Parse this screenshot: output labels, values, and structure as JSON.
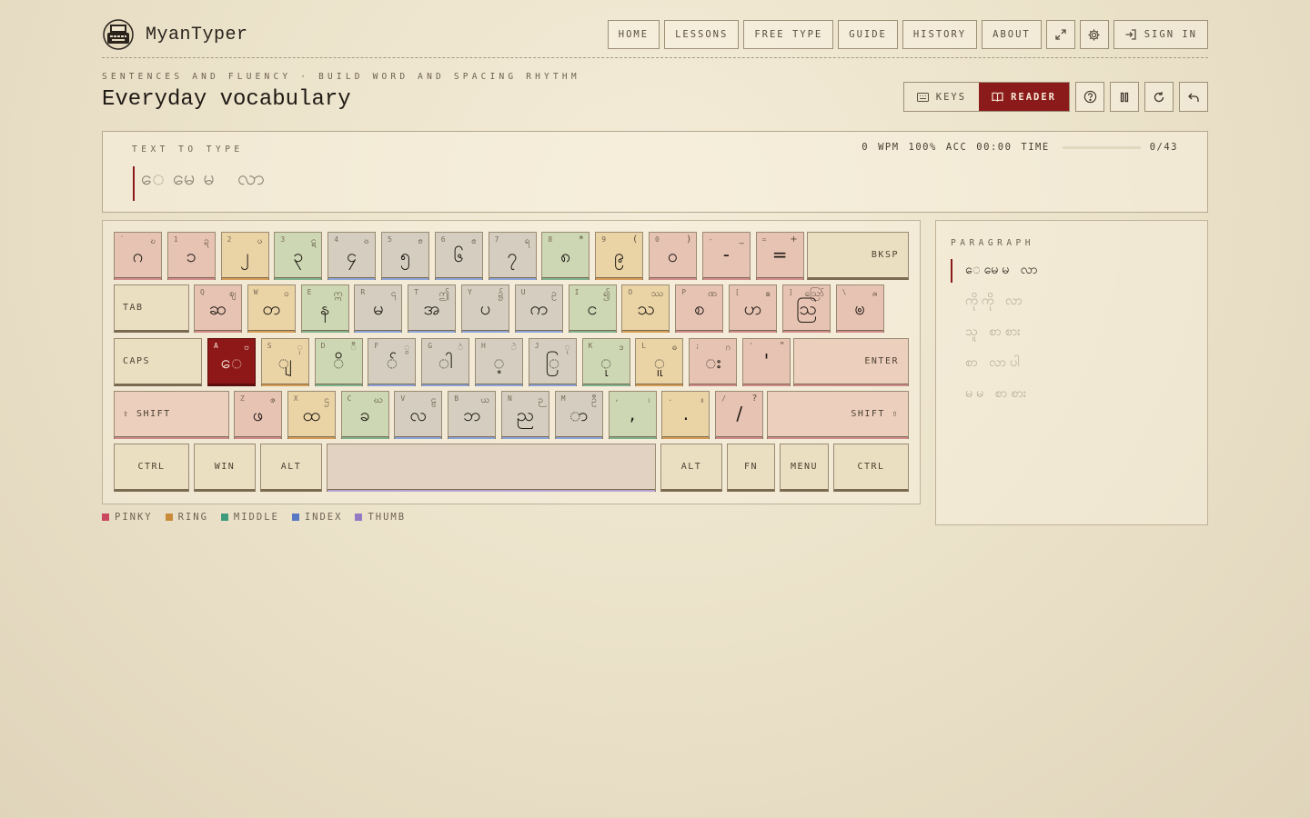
{
  "app": {
    "name": "MyanTyper"
  },
  "nav": {
    "home": "HOME",
    "lessons": "LESSONS",
    "free_type": "FREE TYPE",
    "guide": "GUIDE",
    "history": "HISTORY",
    "about": "ABOUT",
    "sign_in": "SIGN IN"
  },
  "lesson": {
    "eyebrow": "SENTENCES AND FLUENCY · BUILD WORD AND SPACING RHYTHM",
    "title": "Everyday vocabulary"
  },
  "modes": {
    "keys": "KEYS",
    "reader": "READER",
    "active": "reader"
  },
  "text_panel": {
    "label": "TEXT TO TYPE",
    "target": "ေမေမ လာ",
    "wpm": "0",
    "wpm_label": "WPM",
    "acc": "100%",
    "acc_label": "ACC",
    "time": "00:00",
    "time_label": "TIME",
    "progress_fraction": 0,
    "count": "0/43"
  },
  "keyboard": {
    "rows": [
      [
        {
          "l": "`",
          "m": "ဂ",
          "s": "ဎ",
          "f": "pinky"
        },
        {
          "l": "1",
          "m": "၁",
          "s": "ဍ",
          "f": "pinky"
        },
        {
          "l": "2",
          "m": "၂",
          "s": "ၒ",
          "f": "ring"
        },
        {
          "l": "3",
          "m": "၃",
          "s": "ဋ",
          "f": "middle"
        },
        {
          "l": "4",
          "m": "၄",
          "s": "ၓ",
          "f": "index"
        },
        {
          "l": "5",
          "m": "၅",
          "s": "ၔ",
          "f": "index"
        },
        {
          "l": "6",
          "m": "၆",
          "s": "ၕ",
          "f": "index"
        },
        {
          "l": "7",
          "m": "၇",
          "s": "ရ",
          "f": "index"
        },
        {
          "l": "8",
          "m": "၈",
          "s": "*",
          "f": "middle"
        },
        {
          "l": "9",
          "m": "၉",
          "s": "(",
          "f": "ring"
        },
        {
          "l": "0",
          "m": "၀",
          "s": ")",
          "f": "pinky"
        },
        {
          "l": "-",
          "m": "-",
          "s": "_",
          "f": "pinky"
        },
        {
          "l": "=",
          "m": "=",
          "s": "+",
          "f": "pinky"
        }
      ],
      [
        {
          "l": "Q",
          "m": "ဆ",
          "s": "ဈ",
          "f": "pinky"
        },
        {
          "l": "W",
          "m": "တ",
          "s": "ဝ",
          "f": "ring"
        },
        {
          "l": "E",
          "m": "န",
          "s": "ဣ",
          "f": "middle"
        },
        {
          "l": "R",
          "m": "မ",
          "s": "၎",
          "f": "index"
        },
        {
          "l": "T",
          "m": "အ",
          "s": "ဤ",
          "f": "index"
        },
        {
          "l": "Y",
          "m": "ပ",
          "s": "၌",
          "f": "index"
        },
        {
          "l": "U",
          "m": "က",
          "s": "ဥ",
          "f": "index"
        },
        {
          "l": "I",
          "m": "င",
          "s": "၍",
          "f": "middle"
        },
        {
          "l": "O",
          "m": "သ",
          "s": "ဿ",
          "f": "ring"
        },
        {
          "l": "P",
          "m": "စ",
          "s": "ဏ",
          "f": "pinky"
        },
        {
          "l": "[",
          "m": "ဟ",
          "s": "ဧ",
          "f": "pinky"
        },
        {
          "l": "]",
          "m": "ဩ",
          "s": "ဪ",
          "f": "pinky"
        },
        {
          "l": "\\",
          "m": "ၑ",
          "s": "ၐ",
          "f": "pinky"
        }
      ],
      [
        {
          "l": "A",
          "m": "ေ",
          "s": "ဗ",
          "f": "active"
        },
        {
          "l": "S",
          "m": "ျ",
          "s": "ှ",
          "f": "ring"
        },
        {
          "l": "D",
          "m": "ိ",
          "s": "ီ",
          "f": "middle"
        },
        {
          "l": "F",
          "m": "်",
          "s": "ွ",
          "f": "index"
        },
        {
          "l": "G",
          "m": "ါ",
          "s": "ံ",
          "f": "index"
        },
        {
          "l": "H",
          "m": "့",
          "s": "ဲ",
          "f": "index"
        },
        {
          "l": "J",
          "m": "ြ",
          "s": "ု",
          "f": "index"
        },
        {
          "l": "K",
          "m": "ု",
          "s": "ဒ",
          "f": "middle"
        },
        {
          "l": "L",
          "m": "ူ",
          "s": "ဓ",
          "f": "ring"
        },
        {
          "l": ";",
          "m": "း",
          "s": "ဂ",
          "f": "pinky"
        },
        {
          "l": "'",
          "m": "'",
          "s": "\"",
          "f": "pinky"
        }
      ],
      [
        {
          "l": "Z",
          "m": "ဖ",
          "s": "ဇ",
          "f": "pinky"
        },
        {
          "l": "X",
          "m": "ထ",
          "s": "ဌ",
          "f": "ring"
        },
        {
          "l": "C",
          "m": "ခ",
          "s": "ဃ",
          "f": "middle"
        },
        {
          "l": "V",
          "m": "လ",
          "s": "ဠ",
          "f": "index"
        },
        {
          "l": "B",
          "m": "ဘ",
          "s": "ယ",
          "f": "index"
        },
        {
          "l": "N",
          "m": "ည",
          "s": "ဉ",
          "f": "index"
        },
        {
          "l": "M",
          "m": "ာ",
          "s": "ဦ",
          "f": "index"
        },
        {
          "l": ",",
          "m": ",",
          "s": "၊",
          "f": "middle"
        },
        {
          "l": ".",
          "m": ".",
          "s": "။",
          "f": "ring"
        },
        {
          "l": "/",
          "m": "/",
          "s": "?",
          "f": "pinky"
        }
      ]
    ],
    "mods": {
      "bksp": "BKSP",
      "tab": "TAB",
      "caps": "CAPS",
      "enter": "ENTER",
      "lshift": "⇧ SHIFT",
      "rshift": "SHIFT ⇧",
      "lctrl": "CTRL",
      "win": "WIN",
      "lalt": "ALT",
      "ralt": "ALT",
      "fn": "FN",
      "menu": "MENU",
      "rctrl": "CTRL"
    }
  },
  "legend": [
    {
      "label": "PINKY",
      "color": "#c94a5e"
    },
    {
      "label": "RING",
      "color": "#c98a3a"
    },
    {
      "label": "MIDDLE",
      "color": "#3f9b7c"
    },
    {
      "label": "INDEX",
      "color": "#5779c4"
    },
    {
      "label": "THUMB",
      "color": "#9479c4"
    }
  ],
  "paragraph": {
    "label": "PARAGRAPH",
    "lines": [
      "ေမေမ လာ",
      "ကိုကို လာ",
      "သူ စာစား",
      "စာ လာပါ",
      "မမ စာစား"
    ]
  }
}
